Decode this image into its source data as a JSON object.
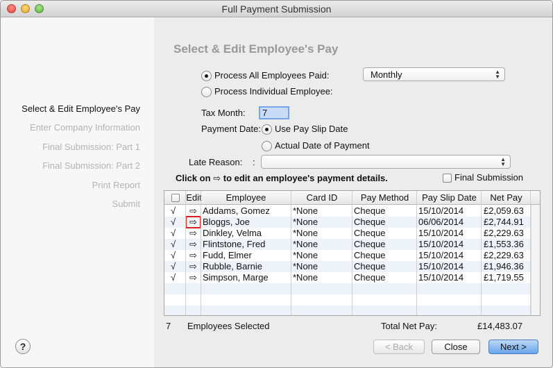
{
  "window": {
    "title": "Full Payment Submission"
  },
  "sidebar": {
    "items": [
      {
        "label": "Select & Edit Employee's Pay",
        "active": true
      },
      {
        "label": "Enter Company Information",
        "active": false
      },
      {
        "label": "Final Submission: Part 1",
        "active": false
      },
      {
        "label": "Final Submission: Part 2",
        "active": false
      },
      {
        "label": "Print Report",
        "active": false
      },
      {
        "label": "Submit",
        "active": false
      }
    ],
    "help_label": "?"
  },
  "main": {
    "heading": "Select & Edit Employee's Pay",
    "process_all_label": "Process All Employees Paid:",
    "process_all_selected": true,
    "frequency_value": "Monthly",
    "process_individual_label": "Process Individual Employee:",
    "tax_month_label": "Tax Month:",
    "tax_month_value": "7",
    "payment_date_label": "Payment Date:",
    "use_pay_slip_label": "Use Pay Slip Date",
    "actual_date_label": "Actual Date of Payment",
    "late_reason_label": "Late Reason:",
    "late_reason_colon": ":",
    "late_reason_value": "",
    "instruction_before": "Click on",
    "instruction_arrow": "⇨",
    "instruction_after": "to edit an employee's payment details.",
    "final_submission_label": "Final Submission",
    "final_submission_checked": false
  },
  "table": {
    "headers": [
      "Edit",
      "Employee",
      "Card ID",
      "Pay Method",
      "Pay Slip Date",
      "Net Pay"
    ],
    "check_mark": "√",
    "edit_icon": "⇨",
    "rows": [
      {
        "employee": "Addams, Gomez",
        "card_id": "*None",
        "pay_method": "Cheque",
        "pay_slip_date": "15/10/2014",
        "net_pay": "£2,059.63"
      },
      {
        "employee": "Bloggs, Joe",
        "card_id": "*None",
        "pay_method": "Cheque",
        "pay_slip_date": "06/06/2014",
        "net_pay": "£2,744.91"
      },
      {
        "employee": "Dinkley, Velma",
        "card_id": "*None",
        "pay_method": "Cheque",
        "pay_slip_date": "15/10/2014",
        "net_pay": "£2,229.63"
      },
      {
        "employee": "Flintstone, Fred",
        "card_id": "*None",
        "pay_method": "Cheque",
        "pay_slip_date": "15/10/2014",
        "net_pay": "£1,553.36"
      },
      {
        "employee": "Fudd, Elmer",
        "card_id": "*None",
        "pay_method": "Cheque",
        "pay_slip_date": "15/10/2014",
        "net_pay": "£2,229.63"
      },
      {
        "employee": "Rubble, Barnie",
        "card_id": "*None",
        "pay_method": "Cheque",
        "pay_slip_date": "15/10/2014",
        "net_pay": "£1,946.36"
      },
      {
        "employee": "Simpson, Marge",
        "card_id": "*None",
        "pay_method": "Cheque",
        "pay_slip_date": "15/10/2014",
        "net_pay": "£1,719.55"
      }
    ]
  },
  "footer": {
    "selected_count": "7",
    "selected_label": "Employees Selected",
    "total_label": "Total Net Pay:",
    "total_value": "£14,483.07"
  },
  "buttons": {
    "back": "< Back",
    "close": "Close",
    "next": "Next >"
  },
  "colors": {
    "accent": "#6aa5ea",
    "highlight": "#e02020",
    "sidebar_inactive": "#b3b3b3"
  }
}
